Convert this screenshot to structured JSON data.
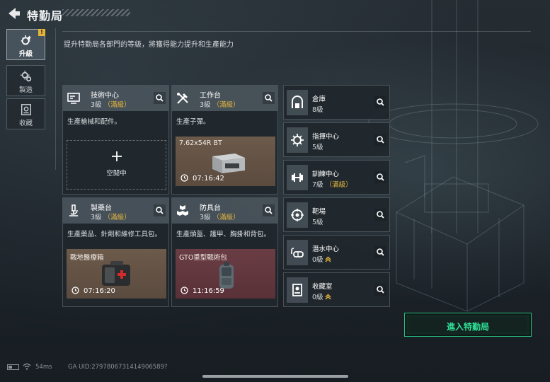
{
  "header": {
    "title": "特勤局"
  },
  "subtitle": "提升特勤局各部門的等級，將獲得能力提升和生產能力",
  "sidebar": {
    "items": [
      {
        "label": "升級",
        "active": true,
        "badge": "!"
      },
      {
        "label": "製造",
        "active": false
      },
      {
        "label": "收藏",
        "active": false
      }
    ]
  },
  "cards": [
    {
      "name": "技術中心",
      "level": "3級",
      "max": "（滿級）",
      "desc": "生產槍械和配件。",
      "slot": {
        "status": "空閒中"
      }
    },
    {
      "name": "工作台",
      "level": "3級",
      "max": "（滿級）",
      "desc": "生產子彈。",
      "slot": {
        "item": "7.62x54R BT",
        "timer": "07:16:42"
      }
    },
    {
      "name": "製藥台",
      "level": "3級",
      "max": "（滿級）",
      "desc": "生產藥品、針劑和維修工具包。",
      "slot": {
        "item": "戰地醫療箱",
        "timer": "07:16:20"
      }
    },
    {
      "name": "防具台",
      "level": "3級",
      "max": "（滿級）",
      "desc": "生產頭盔、護甲、胸掛和背包。",
      "slot": {
        "item": "GTO重型戰術包",
        "timer": "11:16:59"
      }
    }
  ],
  "small_cards": [
    {
      "name": "倉庫",
      "level": "8級",
      "max": ""
    },
    {
      "name": "指揮中心",
      "level": "5級",
      "max": ""
    },
    {
      "name": "訓練中心",
      "level": "7級",
      "max": "（滿級）"
    },
    {
      "name": "靶場",
      "level": "5級",
      "max": ""
    },
    {
      "name": "潛水中心",
      "level": "0級",
      "max": ""
    },
    {
      "name": "收藏室",
      "level": "0級",
      "max": ""
    }
  ],
  "enter_button": "進入特勤局",
  "footer": {
    "ping": "54ms",
    "uid": "GA UID:2797806731414906589?"
  },
  "colors": {
    "accent_green": "#2fe49a",
    "max_gold": "#e6b63d",
    "badge": "#e3b33c"
  }
}
